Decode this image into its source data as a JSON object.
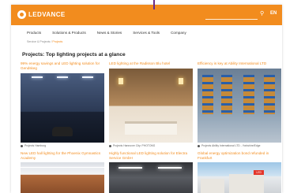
{
  "header": {
    "brand": "LEDVANCE",
    "search_placeholder": "",
    "search_icon": "search-icon",
    "language": "EN",
    "accent_color": "#f28c1e"
  },
  "nav": {
    "items": [
      {
        "label": "Products"
      },
      {
        "label": "Solutions & Products"
      },
      {
        "label": "News & Stories"
      },
      {
        "label": "Services & Tools"
      },
      {
        "label": "Company"
      }
    ]
  },
  "breadcrumb": {
    "parent": "Service & Projects",
    "current": "Projects"
  },
  "main": {
    "title": "Projects: Top lighting projects at a glance",
    "cards": [
      {
        "title": "99% energy savings and LED lighting solution for Gendskeg",
        "caption": "Projects Hamburg"
      },
      {
        "title": "LED lighting at the Radisson Blu hotel",
        "caption": "Projects Hannover City: PHOTONS"
      },
      {
        "title": "Efficiency is key at Ability International LTD",
        "caption": "Projects Ability International LTD - Yorkshire/Edge"
      },
      {
        "title": "New LED hall lighting for the Phoenix Gymnastics Academy",
        "caption": ""
      },
      {
        "title": "Highly functional LED lighting solution for Electra Service GmbH",
        "caption": ""
      },
      {
        "title": "Global energy optimization bond refunded in Frankfurt",
        "caption": ""
      }
    ],
    "office_tag": "LED"
  }
}
